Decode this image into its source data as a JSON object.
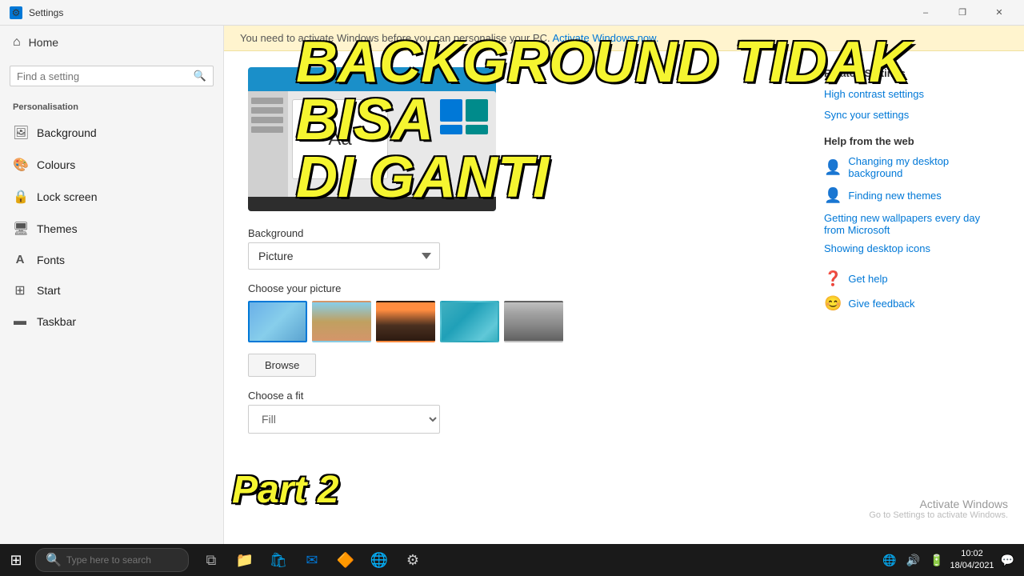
{
  "titlebar": {
    "title": "Settings",
    "minimize": "–",
    "maximize": "❐",
    "close": "✕"
  },
  "sidebar": {
    "search_placeholder": "Find a setting",
    "home_label": "Home",
    "section_label": "Personalisation",
    "items": [
      {
        "id": "background",
        "label": "Background",
        "icon": "🖼"
      },
      {
        "id": "colours",
        "label": "Colours",
        "icon": "🎨"
      },
      {
        "id": "lock-screen",
        "label": "Lock screen",
        "icon": "🔒"
      },
      {
        "id": "themes",
        "label": "Themes",
        "icon": "🖥"
      },
      {
        "id": "fonts",
        "label": "Fonts",
        "icon": "A"
      },
      {
        "id": "start",
        "label": "Start",
        "icon": "⊞"
      },
      {
        "id": "taskbar",
        "label": "Taskbar",
        "icon": "▬"
      }
    ]
  },
  "warning": {
    "text": "You need to activate Windows before you can personalise your PC.",
    "link_text": "Activate Windows now."
  },
  "main": {
    "background_section_title": "Background",
    "dropdown_label": "Background",
    "dropdown_value": "Picture",
    "choose_picture_label": "Choose your picture",
    "browse_button": "Browse",
    "choose_fit_label": "Choose a fit",
    "fit_placeholder": ""
  },
  "related_settings": {
    "title": "Related Settings",
    "links": [
      "High contrast settings",
      "Sync your settings"
    ]
  },
  "help": {
    "title": "Help from the web",
    "links": [
      {
        "icon": "🔗",
        "text": "Changing my desktop background"
      },
      {
        "icon": "🔗",
        "text": "Finding new themes"
      },
      {
        "icon": "🔗",
        "text": "Getting new wallpapers every day from Microsoft"
      },
      {
        "icon": "🔗",
        "text": "Showing desktop icons"
      }
    ],
    "get_help_label": "Get help",
    "feedback_label": "Give feedback"
  },
  "overlay": {
    "line1": "BACKGROUND TIDAK BISA",
    "line2": "DI GANTI",
    "part2": "Part 2"
  },
  "activate": {
    "title": "Activate Windows",
    "subtitle": "Go to Settings to activate Windows."
  },
  "taskbar": {
    "search_placeholder": "Type here to search",
    "time": "10:02",
    "date": "18/04/2021"
  }
}
